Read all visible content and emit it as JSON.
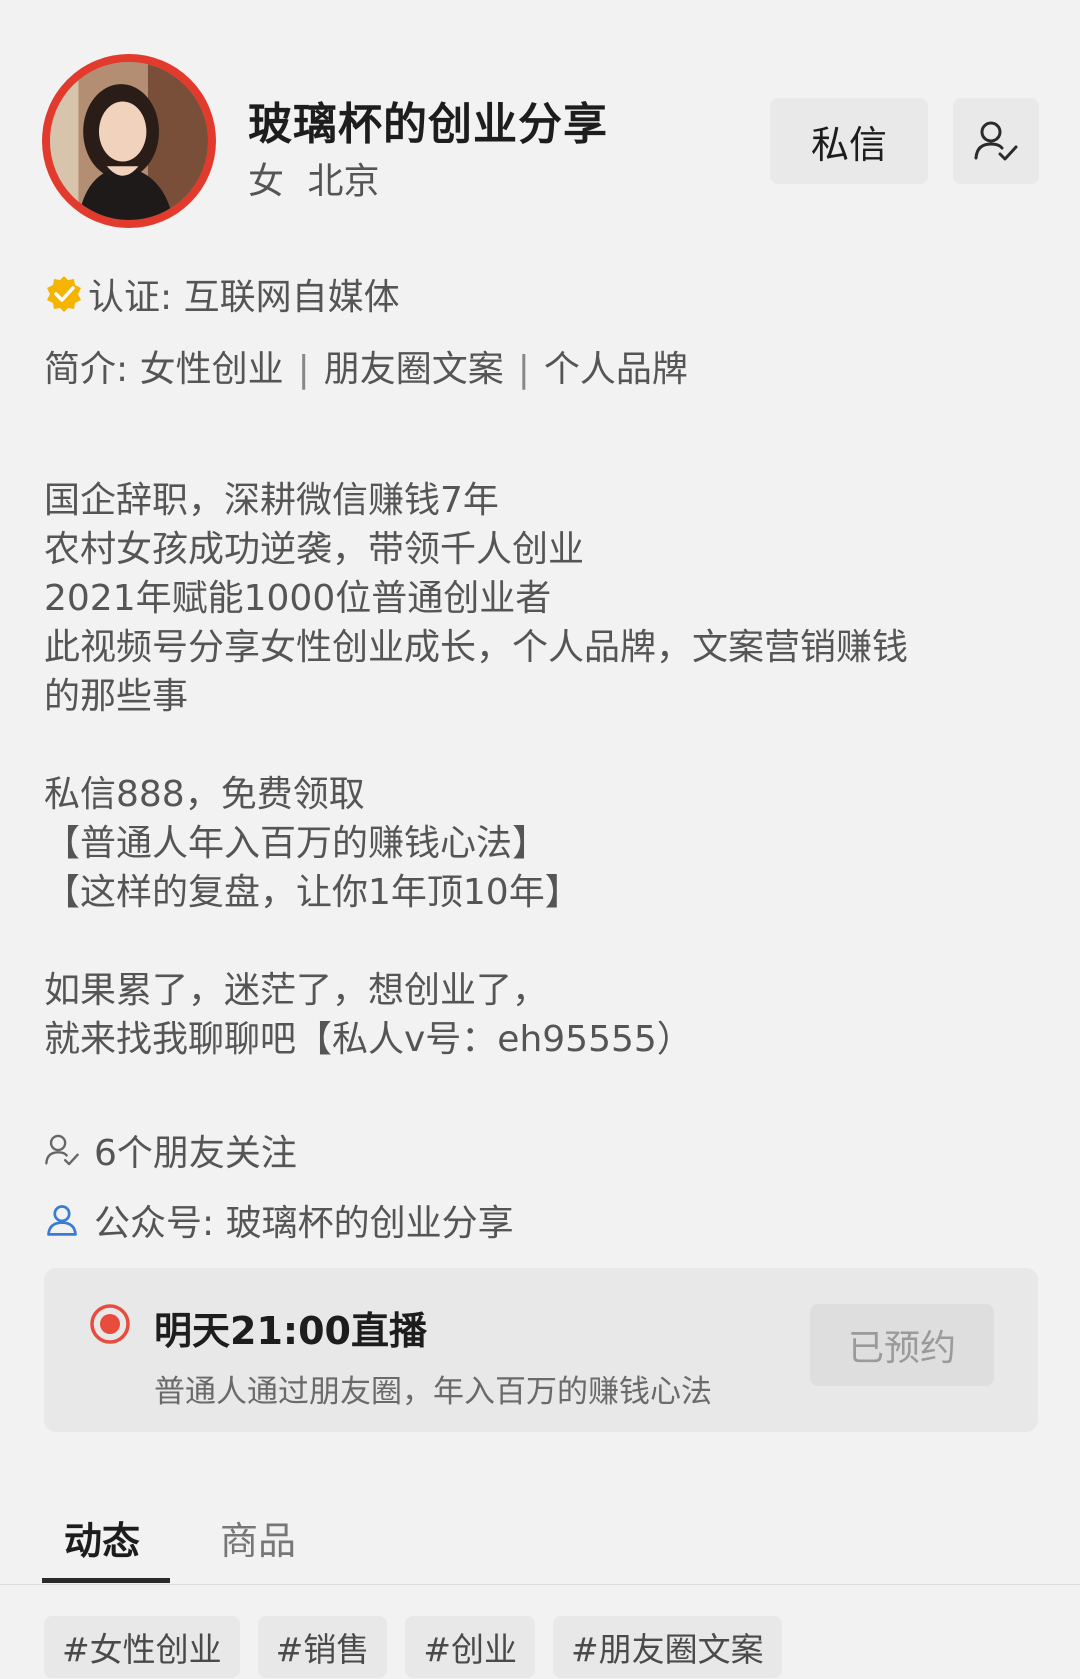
{
  "profile": {
    "name": "玻璃杯的创业分享",
    "gender": "女",
    "city": "北京"
  },
  "actions": {
    "message_label": "私信",
    "follow_icon": "user-check-icon"
  },
  "verification": {
    "text": "认证: 互联网自媒体",
    "badge_color": "#f5b400"
  },
  "intro": {
    "prefix": "简介: ",
    "items": [
      "女性创业",
      "朋友圈文案",
      "个人品牌"
    ],
    "separator": "|"
  },
  "bio": {
    "lines": [
      "国企辞职，深耕微信赚钱7年",
      "农村女孩成功逆袭，带领千人创业",
      "2021年赋能1000位普通创业者",
      "此视频号分享女性创业成长，个人品牌，文案营销赚钱",
      "的那些事",
      "",
      "私信888，免费领取",
      "【普通人年入百万的赚钱心法】",
      " 【这样的复盘，让你1年顶10年】",
      "",
      "如果累了，迷茫了，想创业了，",
      "就来找我聊聊吧【私人v号：eh95555）"
    ]
  },
  "friends": {
    "text": "6个朋友关注"
  },
  "official_account": {
    "text": "公众号: 玻璃杯的创业分享",
    "icon_color": "#3a7bd5"
  },
  "live": {
    "title": "明天21:00直播",
    "subtitle": "普通人通过朋友圈，年入百万的赚钱心法",
    "button_label": "已预约",
    "dot_color": "#e84c3d"
  },
  "tabs": {
    "items": [
      "动态",
      "商品"
    ],
    "active": "动态"
  },
  "tags": [
    "#女性创业",
    "#销售",
    "#创业",
    "#朋友圈文案"
  ]
}
